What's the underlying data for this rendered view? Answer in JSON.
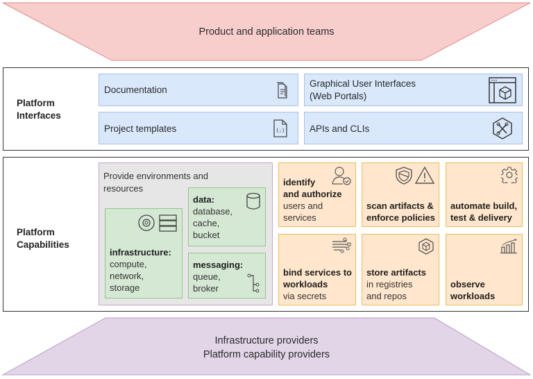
{
  "top_layer": {
    "label": "Product and application teams",
    "fill": "#f8cecc",
    "stroke": "#e08a87"
  },
  "bottom_layer": {
    "lines": [
      "Infrastructure providers",
      "Platform capability providers"
    ],
    "fill": "#e1d5e7",
    "stroke": "#b99cc8"
  },
  "interfaces": {
    "title_lines": [
      "Platform",
      "Interfaces"
    ],
    "items": [
      {
        "label": "Documentation",
        "icon": "document-icon"
      },
      {
        "label_lines": [
          "Graphical User Interfaces",
          "(Web Portals)"
        ],
        "icon": "web-portal-icon"
      },
      {
        "label": "Project templates",
        "icon": "template-file-icon"
      },
      {
        "label": "APIs and CLIs",
        "icon": "tools-icon"
      }
    ]
  },
  "capabilities": {
    "title_lines": [
      "Platform",
      "Capabilities"
    ],
    "environments": {
      "title_lines": [
        "Provide environments and",
        "resources"
      ],
      "infrastructure": {
        "heading": "infrastructure:",
        "lines": [
          "compute,",
          "network,",
          "storage"
        ]
      },
      "data": {
        "heading": "data:",
        "lines": [
          "database,",
          "cache,",
          "bucket"
        ]
      },
      "messaging": {
        "heading": "messaging:",
        "lines": [
          "queue,",
          "broker"
        ]
      }
    },
    "tiles": [
      {
        "bold_lines": [
          "identify",
          "and authorize"
        ],
        "lines": [
          "users and",
          "services"
        ],
        "icon": "user-check-icon"
      },
      {
        "bold_lines": [
          "scan artifacts &",
          "enforce policies"
        ],
        "lines": [],
        "icon": "shield-warning-icon"
      },
      {
        "bold_lines": [
          "automate build,",
          "test & delivery"
        ],
        "lines": [],
        "icon": "gear-icon"
      },
      {
        "bold_lines": [
          "bind services to",
          "workloads"
        ],
        "lines": [
          "via secrets"
        ],
        "icon": "connections-icon"
      },
      {
        "bold_lines": [
          "store artifacts"
        ],
        "lines": [
          "in registries",
          "and repos"
        ],
        "icon": "package-icon"
      },
      {
        "bold_lines": [
          "observe",
          "workloads"
        ],
        "lines": [],
        "icon": "chart-icon"
      }
    ]
  }
}
